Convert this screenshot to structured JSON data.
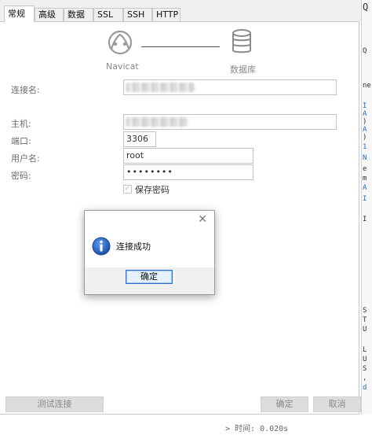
{
  "tabs": [
    {
      "label": "常规",
      "active": true
    },
    {
      "label": "高级",
      "active": false
    },
    {
      "label": "数据库",
      "active": false
    },
    {
      "label": "SSL",
      "active": false
    },
    {
      "label": "SSH",
      "active": false
    },
    {
      "label": "HTTP",
      "active": false
    }
  ],
  "diagram": {
    "left_label": "Navicat",
    "right_label": "数据库",
    "left_icon": "navicat-logo-icon",
    "right_icon": "database-icon"
  },
  "form": {
    "connection_name_label": "连接名:",
    "host_label": "主机:",
    "port_label": "端口:",
    "port_value": "3306",
    "username_label": "用户名:",
    "username_value": "root",
    "password_label": "密码:",
    "password_value": "••••••••",
    "save_password_label": "保存密码",
    "save_password_checked": true
  },
  "dialog": {
    "icon": "info-icon",
    "message": "连接成功",
    "ok_label": "确定",
    "close_icon": "close-icon"
  },
  "bottom": {
    "test_label": "测试连接",
    "ok_label": "确定",
    "cancel_label": "取消"
  },
  "background": {
    "right_strip_lines": [
      "Q",
      "",
      "ne",
      "",
      "I",
      "A",
      ")",
      "A",
      ")",
      "1",
      "N",
      "e",
      "m",
      "A",
      "I",
      "",
      "I"
    ],
    "right_strip_lines2": [
      "S",
      "T",
      "U",
      "",
      "L",
      "U",
      "S",
      ",",
      "d"
    ],
    "bottom_text": "> 时间: 0.020s",
    "accent": "#1f6fc8"
  }
}
